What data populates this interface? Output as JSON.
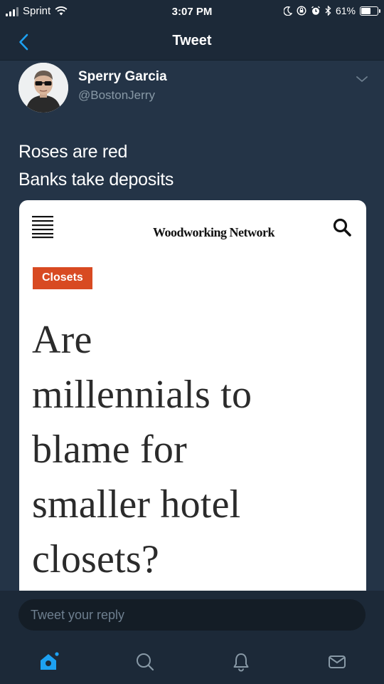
{
  "status_bar": {
    "carrier": "Sprint",
    "time": "3:07 PM",
    "battery_percent": "61%",
    "battery_level": 0.61
  },
  "nav": {
    "title": "Tweet",
    "back_icon": "chevron-left-icon"
  },
  "tweet": {
    "user_name": "Sperry Garcia",
    "handle": "@BostonJerry",
    "text_lines": [
      "Roses are red",
      "Banks take deposits"
    ]
  },
  "embedded_article": {
    "site_name": "Woodworking Network",
    "category": "Closets",
    "headline_lines": [
      "Are",
      "millennials to",
      "blame for",
      "smaller hotel",
      "closets?"
    ]
  },
  "reply": {
    "placeholder": "Tweet your reply"
  },
  "tabs": [
    {
      "name": "home",
      "icon": "home-icon",
      "active": true
    },
    {
      "name": "search",
      "icon": "search-icon",
      "active": false
    },
    {
      "name": "notifications",
      "icon": "bell-icon",
      "active": false
    },
    {
      "name": "messages",
      "icon": "envelope-icon",
      "active": false
    }
  ],
  "colors": {
    "background": "#243447",
    "bar": "#1c2938",
    "accent": "#1da1f2",
    "tag": "#d84a22",
    "muted": "#8899a6"
  }
}
